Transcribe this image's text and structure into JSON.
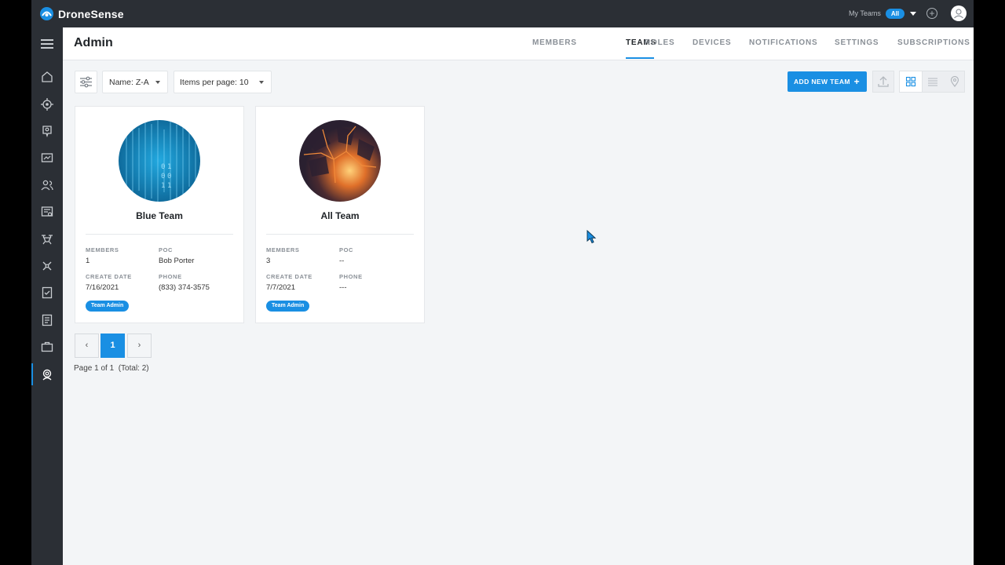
{
  "brand": {
    "name": "DroneSense",
    "icon": "dronesense-logo-icon"
  },
  "topbar": {
    "my_teams_label": "My Teams",
    "team_filter": "All"
  },
  "page": {
    "title": "Admin"
  },
  "tabs": [
    {
      "label": "MEMBERS",
      "active": false
    },
    {
      "label": "TEAMS",
      "active": true
    },
    {
      "label": "ROLES",
      "active": false
    },
    {
      "label": "DEVICES",
      "active": false
    },
    {
      "label": "NOTIFICATIONS",
      "active": false
    },
    {
      "label": "SETTINGS",
      "active": false
    },
    {
      "label": "SUBSCRIPTIONS",
      "active": false
    }
  ],
  "toolbar": {
    "sort_value": "Name: Z-A",
    "per_page_value": "Items per page: 10",
    "add_button": "ADD NEW TEAM",
    "add_icon": "+"
  },
  "labels": {
    "members": "MEMBERS",
    "poc": "POC",
    "create_date": "CREATE DATE",
    "phone": "PHONE"
  },
  "teams": [
    {
      "name": "Blue Team",
      "members": "1",
      "poc": "Bob Porter",
      "create_date": "7/16/2021",
      "phone": "(833) 374-3575",
      "role": "Team Admin"
    },
    {
      "name": "All Team",
      "members": "3",
      "poc": "--",
      "create_date": "7/7/2021",
      "phone": "---",
      "role": "Team Admin"
    }
  ],
  "pagination": {
    "prev": "‹",
    "current": "1",
    "next": "›",
    "info": "Page 1 of 1",
    "total": "(Total: 2)"
  },
  "colors": {
    "accent": "#1a8fe3",
    "nav_bg": "#2b2f35",
    "page_bg": "#f3f5f7"
  }
}
